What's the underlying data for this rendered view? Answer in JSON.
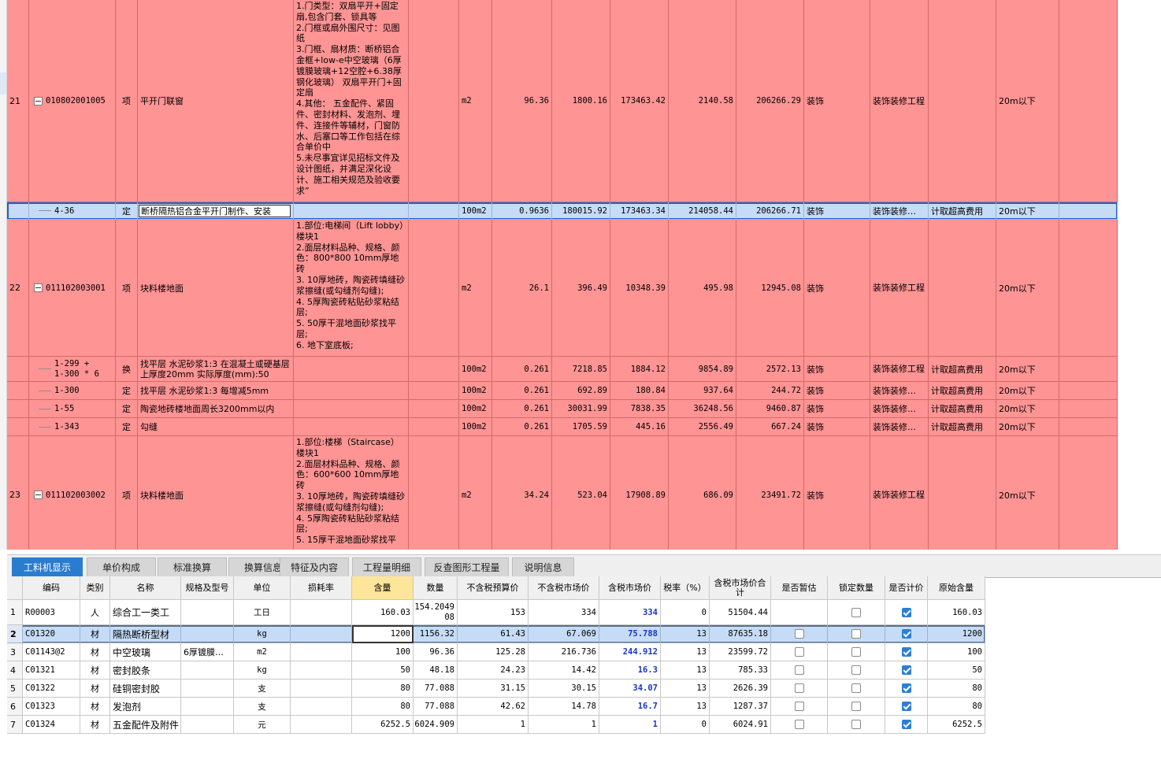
{
  "upper_rows": [
    {
      "row_no": "21",
      "code": "010802001005",
      "type": "项",
      "name": "平开门联窗",
      "desc": "1.门类型：双扇平开+固定扇,包含门套、锁具等\n2.门框或扇外围尺寸：见图纸\n3.门框、扇材质：断桥铝合金框+low-e中空玻璃（6厚镀膜玻璃+12空腔+6.38厚钢化玻璃） 双扇平开门+固定扇\n4.其他： 五金配件、紧固件、密封材料、发泡剂、埋件、连接件等辅材，门窗防水、后塞口等工作包括在综合单价中\n5.未尽事宜详见招标文件及设计图纸，并满足深化设计、施工相关规范及验收要求”",
      "unit": "m2",
      "qty": "96.36",
      "up": "1800.16",
      "total": "173463.42",
      "tup": "2140.58",
      "ttotal": "206266.29",
      "major": "装饰",
      "fee": "装饰装修工程",
      "extra": "",
      "height": "20m以下"
    },
    {
      "row_no": "",
      "code": "4-36",
      "type": "定",
      "name": "断桥隔热铝合金平开门制作、安装",
      "desc": "",
      "unit": "100m2",
      "qty": "0.9636",
      "up": "180015.92",
      "total": "173463.34",
      "tup": "214058.44",
      "ttotal": "206266.71",
      "major": "装饰",
      "fee": "装饰装修…",
      "extra": "计取超高费用",
      "height": "20m以下"
    },
    {
      "row_no": "22",
      "code": "011102003001",
      "type": "项",
      "name": "块料楼地面",
      "desc": "1.部位:电梯间（Lift lobby）楼块1\n2.面层材料品种、规格、颜色：800*800 10mm厚地砖\n3. 10厚地砖，陶瓷砖填缝砂浆擦缝(或勾缝剂勾缝);\n4. 5厚陶瓷砖粘贴砂浆粘结层;\n5. 50厚干混地面砂浆找平层;\n6. 地下室底板;",
      "unit": "m2",
      "qty": "26.1",
      "up": "396.49",
      "total": "10348.39",
      "tup": "495.98",
      "ttotal": "12945.08",
      "major": "装饰",
      "fee": "装饰装修工程",
      "extra": "",
      "height": "20m以下"
    },
    {
      "row_no": "",
      "code": "1-299 +\n1-300 * 6",
      "type": "换",
      "name": "找平层 水泥砂浆1:3 在混凝土或硬基层上厚度20mm  实际厚度(mm):50",
      "desc": "",
      "unit": "100m2",
      "qty": "0.261",
      "up": "7218.85",
      "total": "1884.12",
      "tup": "9854.89",
      "ttotal": "2572.13",
      "major": "装饰",
      "fee": "装饰装修工程",
      "extra": "计取超高费用",
      "height": "20m以下"
    },
    {
      "row_no": "",
      "code": "1-300",
      "type": "定",
      "name": "找平层 水泥砂浆1:3 每增减5mm",
      "desc": "",
      "unit": "100m2",
      "qty": "0.261",
      "up": "692.89",
      "total": "180.84",
      "tup": "937.64",
      "ttotal": "244.72",
      "major": "装饰",
      "fee": "装饰装修…",
      "extra": "计取超高费用",
      "height": "20m以下"
    },
    {
      "row_no": "",
      "code": "1-55",
      "type": "定",
      "name": "陶瓷地砖楼地面周长3200mm以内",
      "desc": "",
      "unit": "100m2",
      "qty": "0.261",
      "up": "30031.99",
      "total": "7838.35",
      "tup": "36248.56",
      "ttotal": "9460.87",
      "major": "装饰",
      "fee": "装饰装修…",
      "extra": "计取超高费用",
      "height": "20m以下"
    },
    {
      "row_no": "",
      "code": "1-343",
      "type": "定",
      "name": "勾缝",
      "desc": "",
      "unit": "100m2",
      "qty": "0.261",
      "up": "1705.59",
      "total": "445.16",
      "tup": "2556.49",
      "ttotal": "667.24",
      "major": "装饰",
      "fee": "装饰装修…",
      "extra": "计取超高费用",
      "height": "20m以下"
    },
    {
      "row_no": "23",
      "code": "011102003002",
      "type": "项",
      "name": "块料楼地面",
      "desc": "1.部位:楼梯（Staircase）楼块1\n2.面层材料品种、规格、颜色：600*600 10mm厚地砖\n3. 10厚地砖，陶瓷砖填缝砂浆擦缝(或勾缝剂勾缝);\n4. 5厚陶瓷砖粘贴砂浆粘结层;\n5. 15厚干混地面砂浆找平",
      "unit": "m2",
      "qty": "34.24",
      "up": "523.04",
      "total": "17908.89",
      "tup": "686.09",
      "ttotal": "23491.72",
      "major": "装饰",
      "fee": "装饰装修工程",
      "extra": "",
      "height": "20m以下"
    }
  ],
  "tabs": [
    "工料机显示",
    "单价构成",
    "标准换算",
    "换算信息",
    "特征及内容",
    "工程量明细",
    "反查图形工程量",
    "说明信息"
  ],
  "lower_headers": [
    "编码",
    "类别",
    "名称",
    "规格及型号",
    "单位",
    "损耗率",
    "含量",
    "数量",
    "不含税预算价",
    "不含税市场价",
    "含税市场价",
    "税率（%）",
    "含税市场价合计",
    "是否暂估",
    "锁定数量",
    "是否计价",
    "原始含量"
  ],
  "lower_rows": [
    {
      "no": "1",
      "code": "R00003",
      "cat": "人",
      "name": "综合工一类工",
      "spec": "",
      "unit": "工日",
      "loss": "",
      "content": "160.03",
      "qty": "154.2049\n08",
      "budget": "153",
      "market": "334",
      "taxmarket": "334",
      "rate": "0",
      "taxtotal": "51504.44",
      "orig": "160.03"
    },
    {
      "no": "2",
      "code": "C01320",
      "cat": "材",
      "name": "隔热断桥型材",
      "spec": "",
      "unit": "kg",
      "loss": "",
      "content": "1200",
      "qty": "1156.32",
      "budget": "61.43",
      "market": "67.069",
      "taxmarket": "75.788",
      "rate": "13",
      "taxtotal": "87635.18",
      "orig": "1200"
    },
    {
      "no": "3",
      "code": "C01143@2",
      "cat": "材",
      "name": "中空玻璃",
      "spec": "6厚镀膜…",
      "unit": "m2",
      "loss": "",
      "content": "100",
      "qty": "96.36",
      "budget": "125.28",
      "market": "216.736",
      "taxmarket": "244.912",
      "rate": "13",
      "taxtotal": "23599.72",
      "orig": "100"
    },
    {
      "no": "4",
      "code": "C01321",
      "cat": "材",
      "name": "密封胶条",
      "spec": "",
      "unit": "kg",
      "loss": "",
      "content": "50",
      "qty": "48.18",
      "budget": "24.23",
      "market": "14.42",
      "taxmarket": "16.3",
      "rate": "13",
      "taxtotal": "785.33",
      "orig": "50"
    },
    {
      "no": "5",
      "code": "C01322",
      "cat": "材",
      "name": "硅铜密封胶",
      "spec": "",
      "unit": "支",
      "loss": "",
      "content": "80",
      "qty": "77.088",
      "budget": "31.15",
      "market": "30.15",
      "taxmarket": "34.07",
      "rate": "13",
      "taxtotal": "2626.39",
      "orig": "80"
    },
    {
      "no": "6",
      "code": "C01323",
      "cat": "材",
      "name": "发泡剂",
      "spec": "",
      "unit": "支",
      "loss": "",
      "content": "80",
      "qty": "77.088",
      "budget": "42.62",
      "market": "14.78",
      "taxmarket": "16.7",
      "rate": "13",
      "taxtotal": "1287.37",
      "orig": "80"
    },
    {
      "no": "7",
      "code": "C01324",
      "cat": "材",
      "name": "五金配件及附件",
      "spec": "",
      "unit": "元",
      "loss": "",
      "content": "6252.5",
      "qty": "6024.909",
      "budget": "1",
      "market": "1",
      "taxmarket": "1",
      "rate": "0",
      "taxtotal": "6024.91",
      "orig": "6252.5"
    }
  ],
  "colors": {
    "row_pink": "#ff9494",
    "selection_blue": "#c6dcf6",
    "tab_active": "#2a7ccf",
    "header_highlight": "#fde59a",
    "price_blue": "#1a37c6"
  }
}
